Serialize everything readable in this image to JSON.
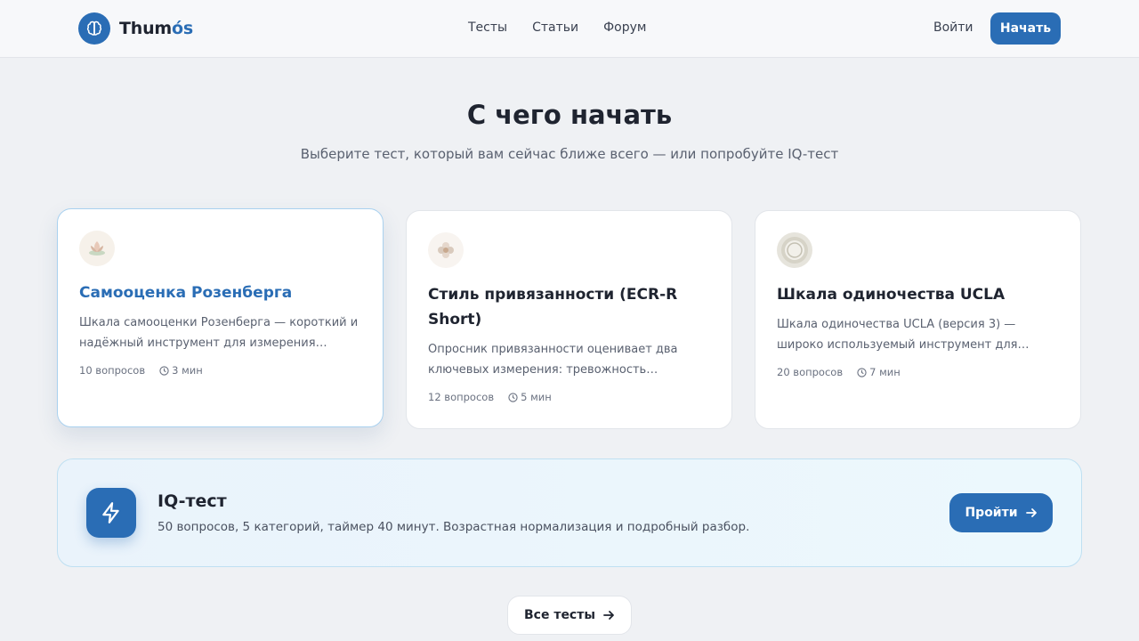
{
  "header": {
    "logo_prefix": "Thum",
    "logo_accent": "ós",
    "logo_icon": "brain-icon",
    "nav": [
      "Тесты",
      "Статьи",
      "Форум"
    ],
    "login": "Войти",
    "start": "Начать"
  },
  "hero": {
    "title": "С чего начать",
    "subtitle": "Выберите тест, который вам сейчас ближе всего — или попробуйте IQ-тест"
  },
  "cards": [
    {
      "title": "Самооценка Розенберга",
      "description": "Шкала самооценки Розенберга — короткий и надёжный инструмент для измерения…",
      "questions": "10 вопросов",
      "time": "3 мин",
      "icon": "lotus-icon"
    },
    {
      "title": "Стиль привязанности (ECR-R Short)",
      "description": "Опросник привязанности оценивает два ключевых измерения: тревожность…",
      "questions": "12 вопросов",
      "time": "5 мин",
      "icon": "flower-icon"
    },
    {
      "title": "Шкала одиночества UCLA",
      "description": "Шкала одиночества UCLA (версия 3) — широко используемый инструмент для…",
      "questions": "20 вопросов",
      "time": "7 мин",
      "icon": "circle-icon"
    }
  ],
  "iq": {
    "title": "IQ-тест",
    "description": "50 вопросов, 5 категорий, таймер 40 минут. Возрастная нормализация и подробный разбор.",
    "button": "Пройти",
    "icon": "lightning-icon"
  },
  "all_tests": "Все тесты",
  "colors": {
    "accent": "#2a6db5",
    "background": "#eff1f4",
    "active_border": "#a9d1ef"
  }
}
